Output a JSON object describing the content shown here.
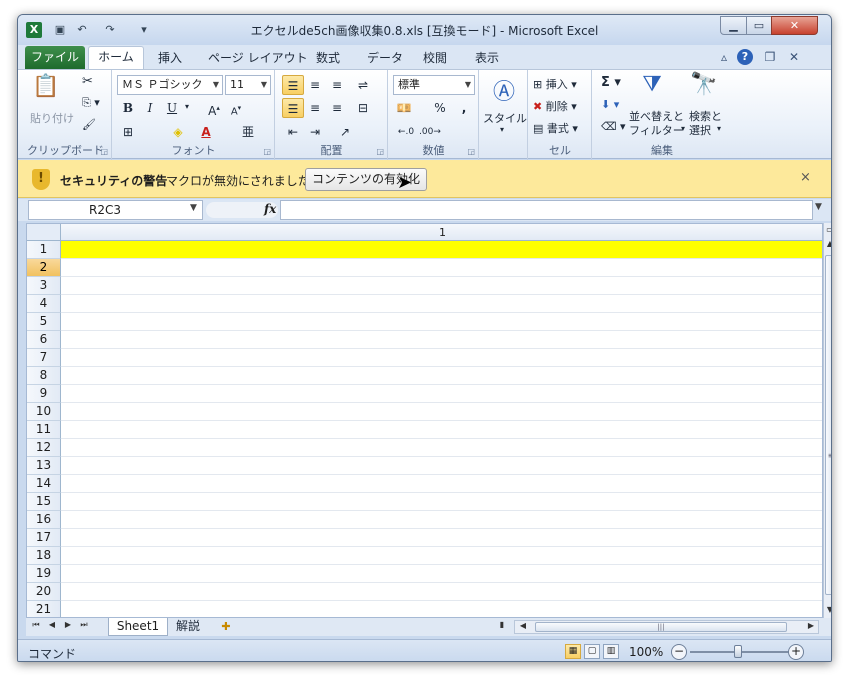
{
  "window": {
    "title": "エクセルde5ch画像収集0.8.xls  [互換モード] - Microsoft Excel",
    "app_icon": "X"
  },
  "quick_access": {
    "save_icon": "save-icon",
    "undo": "↶",
    "redo": "↷",
    "customize": "▾"
  },
  "ribbon_tabs": {
    "file": "ファイル",
    "items": [
      "ホーム",
      "挿入",
      "ページ レイアウト",
      "数式",
      "データ",
      "校閲",
      "表示"
    ]
  },
  "clipboard": {
    "paste_label": "貼り付け",
    "group_label": "クリップボード"
  },
  "font": {
    "name": "ＭＳ Ｐゴシック",
    "size": "11",
    "group_label": "フォント"
  },
  "alignment": {
    "group_label": "配置"
  },
  "number": {
    "format": "標準",
    "percent": "%",
    "comma": ",",
    "group_label": "数値"
  },
  "styles": {
    "label": "スタイル"
  },
  "cells": {
    "insert": "挿入",
    "delete": "削除",
    "format": "書式",
    "group_label": "セル"
  },
  "editing": {
    "sort_line1": "並べ替えと",
    "sort_line2": "フィルター",
    "find_line1": "検索と",
    "find_line2": "選択",
    "group_label": "編集"
  },
  "security": {
    "title": "セキュリティの警告",
    "message": "マクロが無効にされました。",
    "button": "コンテンツの有効化",
    "close": "×"
  },
  "formula_bar": {
    "name_box": "R2C3",
    "fx": "fx",
    "value": ""
  },
  "grid": {
    "column_header": "1",
    "rows": [
      "1",
      "2",
      "3",
      "4",
      "5",
      "6",
      "7",
      "8",
      "9",
      "10",
      "11",
      "12",
      "13",
      "14",
      "15",
      "16",
      "17",
      "18",
      "19",
      "20",
      "21"
    ],
    "selected_row": "2",
    "highlight_row": "1",
    "highlight_color": "#ffff00"
  },
  "sheets": {
    "tabs": [
      "Sheet1",
      "解説"
    ],
    "active": "Sheet1"
  },
  "status": {
    "mode": "コマンド",
    "zoom": "100%"
  },
  "colors": {
    "accent": "#1e6b2d",
    "security_bar": "#fde99b",
    "selection": "#f1c15f"
  }
}
